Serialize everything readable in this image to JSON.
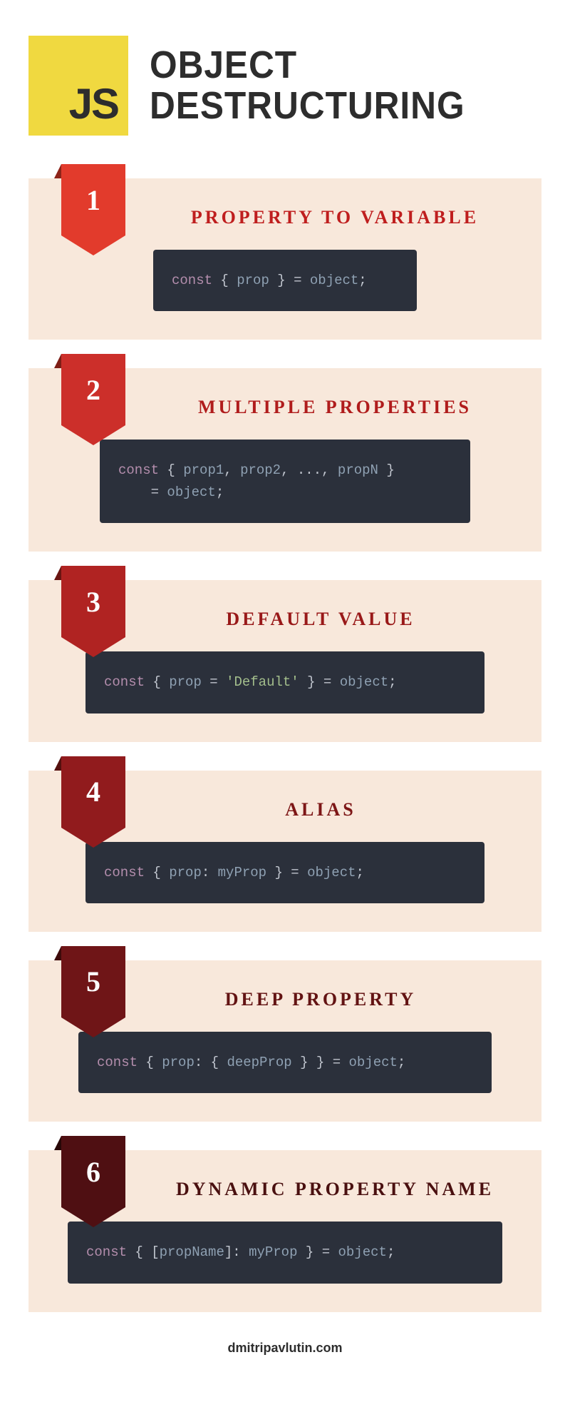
{
  "header": {
    "badge_text": "JS",
    "title_line1": "OBJECT",
    "title_line2": "DESTRUCTURING"
  },
  "sections": [
    {
      "num": "1",
      "title": "PROPERTY TO VARIABLE",
      "code_tokens": [
        {
          "t": "const",
          "c": "kw"
        },
        {
          "t": " { ",
          "c": "pu"
        },
        {
          "t": "prop",
          "c": "id"
        },
        {
          "t": " } ",
          "c": "pu"
        },
        {
          "t": "=",
          "c": "op"
        },
        {
          "t": " object",
          "c": "id"
        },
        {
          "t": ";",
          "c": "pu"
        }
      ]
    },
    {
      "num": "2",
      "title": "MULTIPLE PROPERTIES",
      "code_tokens": [
        {
          "t": "const",
          "c": "kw"
        },
        {
          "t": " { ",
          "c": "pu"
        },
        {
          "t": "prop1",
          "c": "id"
        },
        {
          "t": ", ",
          "c": "pu"
        },
        {
          "t": "prop2",
          "c": "id"
        },
        {
          "t": ", ",
          "c": "pu"
        },
        {
          "t": "...",
          "c": "op"
        },
        {
          "t": ", ",
          "c": "pu"
        },
        {
          "t": "propN",
          "c": "id"
        },
        {
          "t": " }",
          "c": "pu"
        },
        {
          "t": "\n    ",
          "c": "pu"
        },
        {
          "t": "=",
          "c": "op"
        },
        {
          "t": " object",
          "c": "id"
        },
        {
          "t": ";",
          "c": "pu"
        }
      ]
    },
    {
      "num": "3",
      "title": "DEFAULT VALUE",
      "code_tokens": [
        {
          "t": "const",
          "c": "kw"
        },
        {
          "t": " { ",
          "c": "pu"
        },
        {
          "t": "prop",
          "c": "id"
        },
        {
          "t": " ",
          "c": "pu"
        },
        {
          "t": "=",
          "c": "op"
        },
        {
          "t": " ",
          "c": "pu"
        },
        {
          "t": "'Default'",
          "c": "str"
        },
        {
          "t": " } ",
          "c": "pu"
        },
        {
          "t": "=",
          "c": "op"
        },
        {
          "t": " object",
          "c": "id"
        },
        {
          "t": ";",
          "c": "pu"
        }
      ]
    },
    {
      "num": "4",
      "title": "ALIAS",
      "code_tokens": [
        {
          "t": "const",
          "c": "kw"
        },
        {
          "t": " { ",
          "c": "pu"
        },
        {
          "t": "prop",
          "c": "id"
        },
        {
          "t": ": ",
          "c": "pu"
        },
        {
          "t": "myProp",
          "c": "id"
        },
        {
          "t": " } ",
          "c": "pu"
        },
        {
          "t": "=",
          "c": "op"
        },
        {
          "t": " object",
          "c": "id"
        },
        {
          "t": ";",
          "c": "pu"
        }
      ]
    },
    {
      "num": "5",
      "title": "DEEP PROPERTY",
      "code_tokens": [
        {
          "t": "const",
          "c": "kw"
        },
        {
          "t": " { ",
          "c": "pu"
        },
        {
          "t": "prop",
          "c": "id"
        },
        {
          "t": ": { ",
          "c": "pu"
        },
        {
          "t": "deepProp",
          "c": "id"
        },
        {
          "t": " } } ",
          "c": "pu"
        },
        {
          "t": "=",
          "c": "op"
        },
        {
          "t": " object",
          "c": "id"
        },
        {
          "t": ";",
          "c": "pu"
        }
      ]
    },
    {
      "num": "6",
      "title": "DYNAMIC PROPERTY NAME",
      "code_tokens": [
        {
          "t": "const",
          "c": "kw"
        },
        {
          "t": " { [",
          "c": "pu"
        },
        {
          "t": "propName",
          "c": "id"
        },
        {
          "t": "]: ",
          "c": "pu"
        },
        {
          "t": "myProp",
          "c": "id"
        },
        {
          "t": " } ",
          "c": "pu"
        },
        {
          "t": "=",
          "c": "op"
        },
        {
          "t": " object",
          "c": "id"
        },
        {
          "t": ";",
          "c": "pu"
        }
      ]
    }
  ],
  "footer": "dmitripavlutin.com"
}
